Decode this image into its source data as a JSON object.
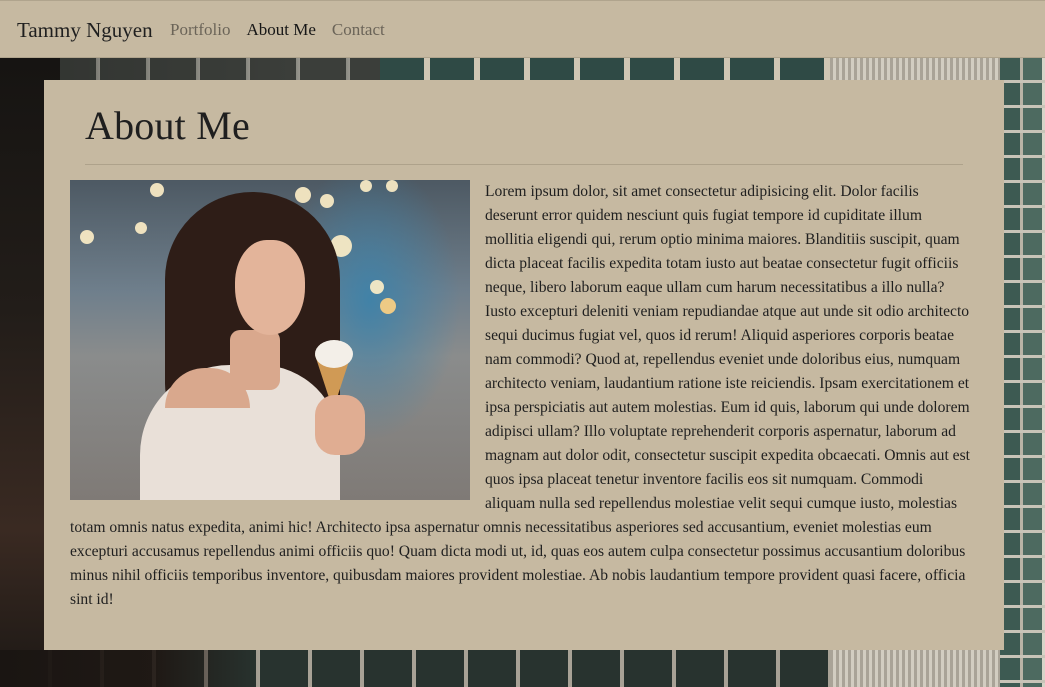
{
  "navbar": {
    "brand": "Tammy Nguyen",
    "links": [
      {
        "label": "Portfolio",
        "active": false
      },
      {
        "label": "About Me",
        "active": true
      },
      {
        "label": "Contact",
        "active": false
      }
    ]
  },
  "main": {
    "title": "About Me",
    "photo_icon": "portrait-photo",
    "paragraph": "Lorem ipsum dolor, sit amet consectetur adipisicing elit. Dolor facilis deserunt error quidem nesciunt quis fugiat tempore id cupiditate illum mollitia eligendi qui, rerum optio minima maiores. Blanditiis suscipit, quam dicta placeat facilis expedita totam iusto aut beatae consectetur fugit officiis neque, libero laborum eaque ullam cum harum necessitatibus a illo nulla? Iusto excepturi deleniti veniam repudiandae atque aut unde sit odio architecto sequi ducimus fugiat vel, quos id rerum! Aliquid asperiores corporis beatae nam commodi? Quod at, repellendus eveniet unde doloribus eius, numquam architecto veniam, laudantium ratione iste reiciendis. Ipsam exercitationem et ipsa perspiciatis aut autem molestias. Eum id quis, laborum qui unde dolorem adipisci ullam? Illo voluptate reprehenderit corporis aspernatur, laborum ad magnam aut dolor odit, consectetur suscipit expedita obcaecati. Omnis aut est quos ipsa placeat tenetur inventore facilis eos sit numquam. Commodi aliquam nulla sed repellendus molestiae velit sequi cumque iusto, molestias totam omnis natus expedita, animi hic! Architecto ipsa aspernatur omnis necessitatibus asperiores sed accusantium, eveniet molestias eum excepturi accusamus repellendus animi officiis quo! Quam dicta modi ut, id, quas eos autem culpa consectetur possimus accusantium doloribus minus nihil officiis temporibus inventore, quibusdam maiores provident molestiae. Ab nobis laudantium tempore provident quasi facere, officia sint id!"
  },
  "colors": {
    "panel": "#c6b9a1",
    "text": "#1f1f1f",
    "nav_inactive": "#6b6458"
  }
}
